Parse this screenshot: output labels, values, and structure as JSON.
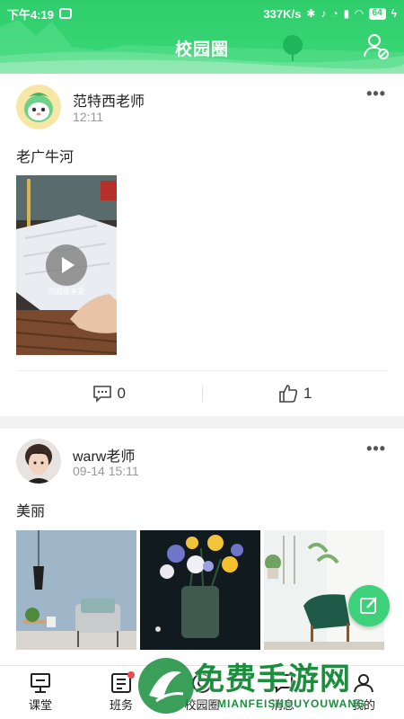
{
  "status_bar": {
    "time": "下午4:19",
    "speed": "337K/s",
    "battery": "64"
  },
  "header": {
    "title": "校园圈"
  },
  "posts": [
    {
      "author": "范特西老师",
      "time": "12:11",
      "text": "老广牛河",
      "video_caption": "的超级享受",
      "comments": "0",
      "likes": "1"
    },
    {
      "author": "warw老师",
      "time": "09-14 15:11",
      "text": "美丽"
    }
  ],
  "nav": {
    "items": [
      {
        "label": "课堂"
      },
      {
        "label": "班务"
      },
      {
        "label": "校园圈"
      },
      {
        "label": "消息"
      },
      {
        "label": "我的"
      }
    ]
  },
  "watermark": {
    "main": "免费手游网",
    "sub": "MIANFEISHOUYOUWANG"
  },
  "colors": {
    "brand": "#2fcd6c",
    "badge": "#f04a4a"
  }
}
